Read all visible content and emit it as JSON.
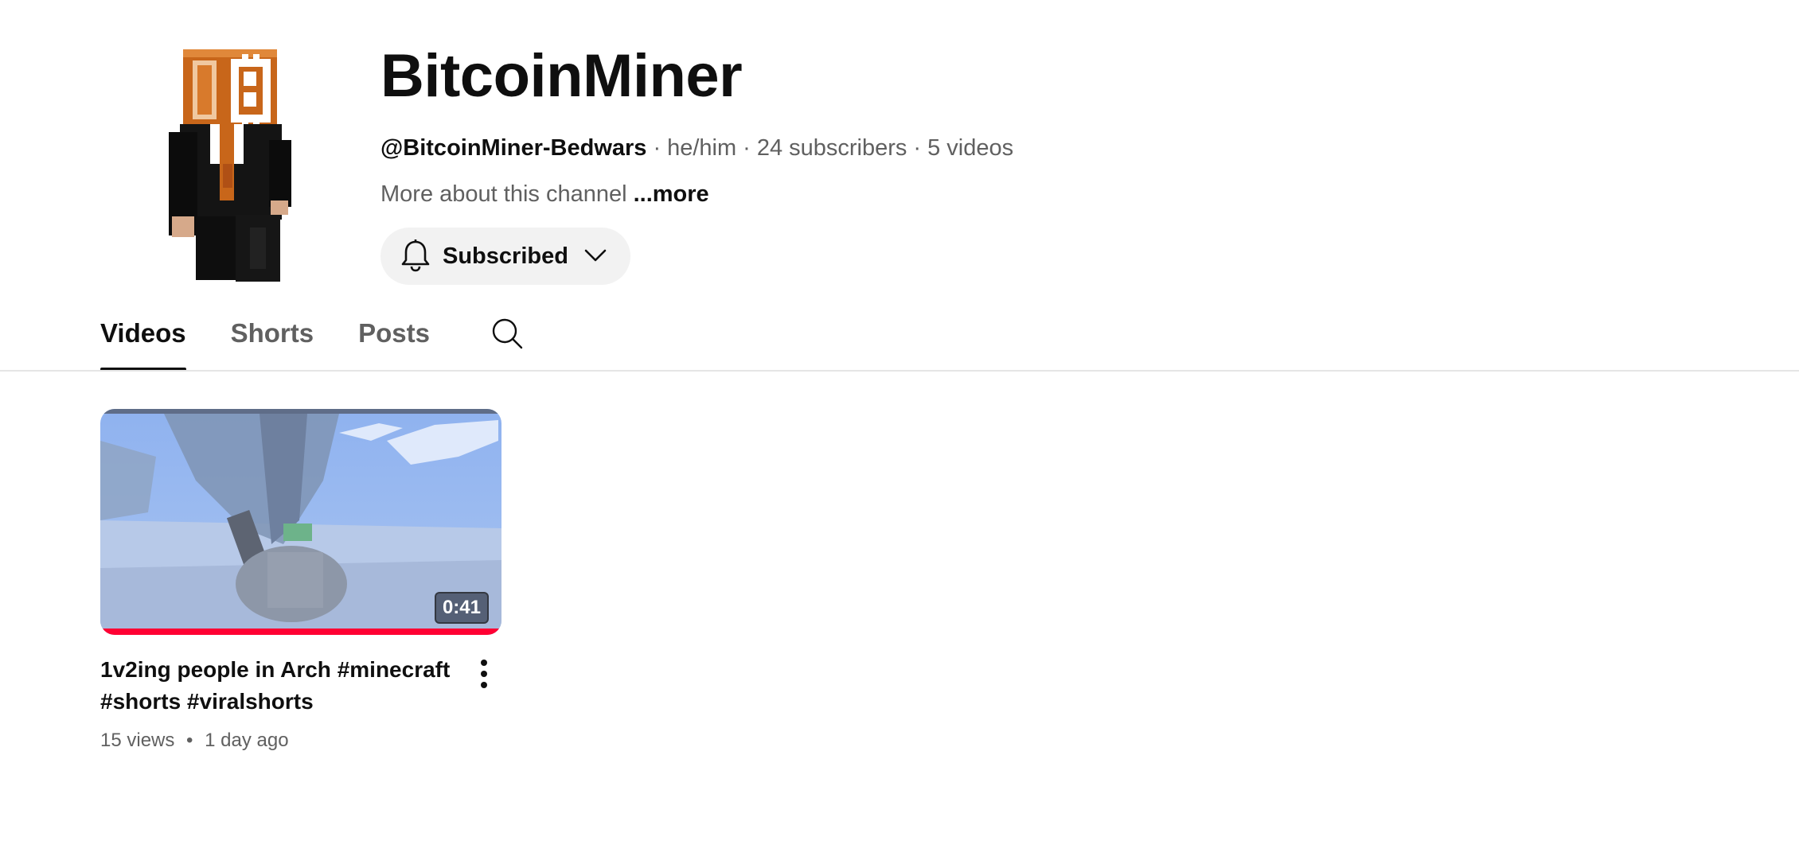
{
  "channel": {
    "name": "BitcoinMiner",
    "handle": "@BitcoinMiner-Bedwars",
    "pronouns": "he/him",
    "subscribers": "24 subscribers",
    "videos": "5 videos",
    "about": "More about this channel",
    "more_link": "...more",
    "subscribe_label": "Subscribed",
    "separator": "·"
  },
  "tabs": [
    {
      "label": "Videos",
      "active": true
    },
    {
      "label": "Shorts",
      "active": false
    },
    {
      "label": "Posts",
      "active": false
    }
  ],
  "videos": [
    {
      "title": "1v2ing people in Arch #minecraft #shorts #viralshorts",
      "views": "15 views",
      "age": "1 day ago",
      "separator": "•",
      "duration": "0:41",
      "watched_fraction": 1.0
    }
  ],
  "colors": {
    "accent": "#ff0033",
    "text_primary": "#0f0f0f",
    "text_secondary": "#606060",
    "button_bg": "#f2f2f2"
  },
  "icons": {
    "bell": "bell-icon",
    "chevron": "chevron-down-icon",
    "search": "search-icon",
    "more": "more-vert-icon"
  }
}
